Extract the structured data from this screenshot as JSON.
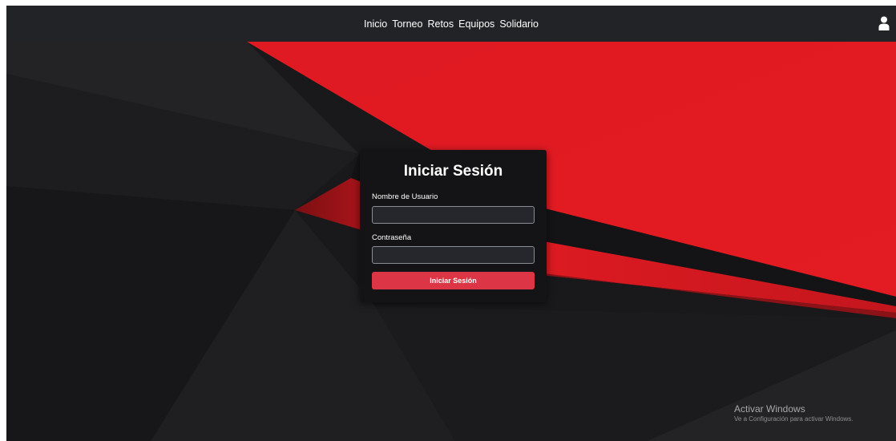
{
  "nav": {
    "items": [
      {
        "label": "Inicio"
      },
      {
        "label": "Torneo"
      },
      {
        "label": "Retos"
      },
      {
        "label": "Equipos"
      },
      {
        "label": "Solidario"
      }
    ],
    "user_icon": "user-icon"
  },
  "login": {
    "title": "Iniciar Sesión",
    "username_label": "Nombre de Usuario",
    "username_value": "",
    "password_label": "Contraseña",
    "password_value": "",
    "submit_label": "Iniciar Sesión"
  },
  "watermark": {
    "title": "Activar Windows",
    "subtitle": "Ve a Configuración para activar Windows."
  },
  "colors": {
    "navbar": "#212326",
    "background_dark": "#1a1a1c",
    "accent_red": "#e31b23",
    "card": "#141416",
    "button": "#dc3545"
  }
}
